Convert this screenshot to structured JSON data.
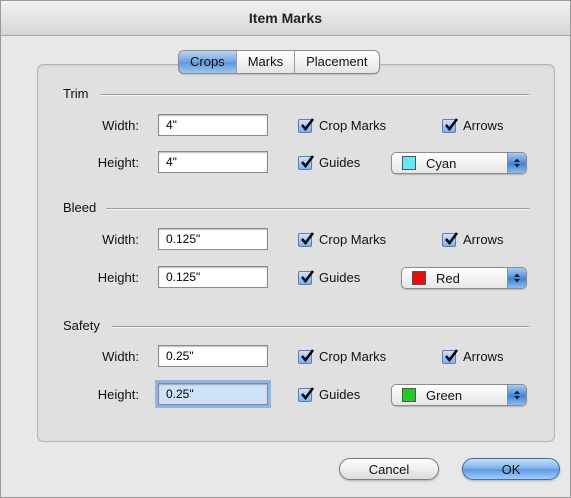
{
  "window": {
    "title": "Item Marks"
  },
  "tabs": [
    {
      "label": "Crops",
      "active": true
    },
    {
      "label": "Marks",
      "active": false
    },
    {
      "label": "Placement",
      "active": false
    }
  ],
  "sections": {
    "trim": {
      "label": "Trim",
      "width_label": "Width:",
      "width_value": "4\"",
      "height_label": "Height:",
      "height_value": "4\"",
      "crop_marks_label": "Crop Marks",
      "crop_marks_checked": true,
      "arrows_label": "Arrows",
      "arrows_checked": true,
      "guides_label": "Guides",
      "guides_checked": true,
      "color_label": "Cyan",
      "color_hex": "#66e8f4"
    },
    "bleed": {
      "label": "Bleed",
      "width_label": "Width:",
      "width_value": "0.125\"",
      "height_label": "Height:",
      "height_value": "0.125\"",
      "crop_marks_label": "Crop Marks",
      "crop_marks_checked": true,
      "arrows_label": "Arrows",
      "arrows_checked": true,
      "guides_label": "Guides",
      "guides_checked": true,
      "color_label": "Red",
      "color_hex": "#e11010"
    },
    "safety": {
      "label": "Safety",
      "width_label": "Width:",
      "width_value": "0.25\"",
      "height_label": "Height:",
      "height_value": "0.25\"",
      "crop_marks_label": "Crop Marks",
      "crop_marks_checked": true,
      "arrows_label": "Arrows",
      "arrows_checked": true,
      "guides_label": "Guides",
      "guides_checked": true,
      "color_label": "Green",
      "color_hex": "#22cc22"
    }
  },
  "buttons": {
    "cancel": "Cancel",
    "ok": "OK"
  }
}
